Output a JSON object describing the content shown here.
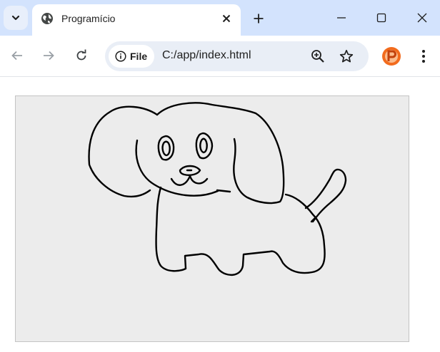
{
  "browser": {
    "tab": {
      "title": "Programício",
      "favicon": "globe-icon"
    },
    "omnibox": {
      "chip_label": "File",
      "url": "C:/app/index.html"
    },
    "icons": {
      "tab_search": "chevron-down-icon",
      "tab_close": "close-icon",
      "new_tab": "plus-icon",
      "minimize": "minimize-icon",
      "maximize": "maximize-icon",
      "close_window": "close-icon",
      "back": "arrow-left-icon",
      "forward": "arrow-right-icon",
      "reload": "reload-icon",
      "info": "info-icon",
      "zoom": "zoom-in-icon",
      "bookmark": "star-icon",
      "profile": "profile-avatar-icon",
      "menu": "kebab-menu-icon"
    },
    "colors": {
      "titlebar": "#d3e3fd",
      "omnibox": "#e9eef6",
      "avatar": "#f26b1d"
    }
  },
  "page": {
    "drawing": {
      "subject": "dog-sketch-icon",
      "background": "#ececec",
      "stroke": "#000000"
    }
  }
}
